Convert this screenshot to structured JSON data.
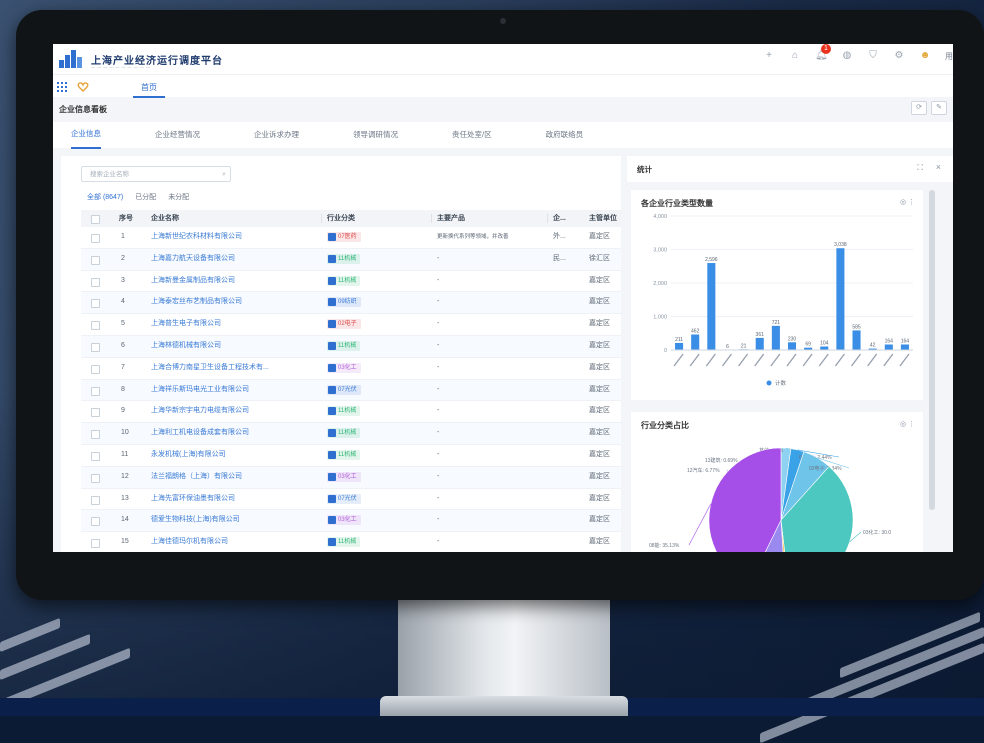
{
  "app": {
    "brand": "上海产业经济运行调度平台",
    "notification_count": "1",
    "user_label": "用"
  },
  "tabs": {
    "home": "首页"
  },
  "page_title": "企业信息看板",
  "subtabs": [
    "企业信息",
    "企业经营情况",
    "企业诉求办理",
    "领导调研情况",
    "责任处室/区",
    "政府联络员"
  ],
  "list": {
    "search_placeholder": "搜索企业名称",
    "filters": [
      "全部 (8647)",
      "已分配",
      "未分配"
    ],
    "columns": [
      "序号",
      "企业名称",
      "行业分类",
      "主要产品",
      "企...",
      "主管单位"
    ],
    "rows": [
      {
        "no": "1",
        "name": "上海新世纪农科材料有限公司",
        "industry": "07医药",
        "industry_color": "#e04b4b",
        "product": "更新换代系列等领域，并改善",
        "unit_short": "外...",
        "dept": "嘉定区"
      },
      {
        "no": "2",
        "name": "上海嘉力航天设备有限公司",
        "industry": "11机械",
        "industry_color": "#2bb673",
        "product": "-",
        "unit_short": "民...",
        "dept": "徐汇区"
      },
      {
        "no": "3",
        "name": "上海新曼金属制品有限公司",
        "industry": "11机械",
        "industry_color": "#2bb673",
        "product": "-",
        "unit_short": "",
        "dept": "嘉定区"
      },
      {
        "no": "4",
        "name": "上海泰宏丝布艺制品有限公司",
        "industry": "09纺织",
        "industry_color": "#3a7bd5",
        "product": "-",
        "unit_short": "",
        "dept": "嘉定区"
      },
      {
        "no": "5",
        "name": "上海普生电子有限公司",
        "industry": "02电子",
        "industry_color": "#e04b4b",
        "product": "-",
        "unit_short": "",
        "dept": "嘉定区"
      },
      {
        "no": "6",
        "name": "上海林德机械有限公司",
        "industry": "11机械",
        "industry_color": "#2bb673",
        "product": "-",
        "unit_short": "",
        "dept": "嘉定区"
      },
      {
        "no": "7",
        "name": "上海合博力南星卫生设备工程技术有...",
        "industry": "03化工",
        "industry_color": "#b35fd6",
        "product": "-",
        "unit_short": "",
        "dept": "嘉定区"
      },
      {
        "no": "8",
        "name": "上海祥乐斯玛电光工业有限公司",
        "industry": "07光伏",
        "industry_color": "#3a7bd5",
        "product": "-",
        "unit_short": "",
        "dept": "嘉定区"
      },
      {
        "no": "9",
        "name": "上海华新宗宇电力电缆有限公司",
        "industry": "11机械",
        "industry_color": "#2bb673",
        "product": "-",
        "unit_short": "",
        "dept": "嘉定区"
      },
      {
        "no": "10",
        "name": "上海利工机电设备成套有限公司",
        "industry": "11机械",
        "industry_color": "#2bb673",
        "product": "-",
        "unit_short": "",
        "dept": "嘉定区"
      },
      {
        "no": "11",
        "name": "永发机械(上海)有限公司",
        "industry": "11机械",
        "industry_color": "#2bb673",
        "product": "-",
        "unit_short": "",
        "dept": "嘉定区"
      },
      {
        "no": "12",
        "name": "法兰福朗格（上海）有限公司",
        "industry": "03化工",
        "industry_color": "#b35fd6",
        "product": "-",
        "unit_short": "",
        "dept": "嘉定区"
      },
      {
        "no": "13",
        "name": "上海先富环保油墨有限公司",
        "industry": "07光伏",
        "industry_color": "#3a7bd5",
        "product": "-",
        "unit_short": "",
        "dept": "嘉定区"
      },
      {
        "no": "14",
        "name": "德爱生物科技(上海)有限公司",
        "industry": "03化工",
        "industry_color": "#b35fd6",
        "product": "-",
        "unit_short": "",
        "dept": "嘉定区"
      },
      {
        "no": "15",
        "name": "上海佳德玛尔机有限公司",
        "industry": "11机械",
        "industry_color": "#2bb673",
        "product": "-",
        "unit_short": "",
        "dept": "嘉定区"
      }
    ]
  },
  "stats": {
    "panel_title": "统计",
    "card1_title": "各企业行业类型数量",
    "card2_title": "行业分类占比"
  },
  "chart_data": [
    {
      "type": "bar",
      "title": "各企业行业类型数量",
      "categories": [
        "c1",
        "c2",
        "c3",
        "c4",
        "c5",
        "c6",
        "c7",
        "c8",
        "c9",
        "c10",
        "c11",
        "c12",
        "c13",
        "c14",
        "c15"
      ],
      "series": [
        {
          "name": "计数",
          "values": [
            211,
            462,
            2596,
            6,
            21,
            361,
            721,
            230,
            69,
            104,
            3038,
            585,
            42,
            164,
            164
          ]
        }
      ],
      "y_ticks": [
        "0",
        "1,000",
        "2,000",
        "3,000",
        "4,000"
      ],
      "ylim": [
        0,
        4000
      ],
      "color": "#3a8ee6"
    },
    {
      "type": "pie",
      "title": "行业分类占比",
      "labels": [
        "其他: 1.8%",
        "01装备: 2.44%",
        "02电子: 5.34%",
        "03化工: 30.0",
        "13建筑: 0.69%",
        "12汽车: 6.77%",
        "08能: 35.13%"
      ],
      "values": [
        1.8,
        2.44,
        5.34,
        30.0,
        0.69,
        6.77,
        35.13
      ],
      "colors": [
        "#8fd1f0",
        "#3aa3e8",
        "#6fc4ea",
        "#4dc8c0",
        "#f5c542",
        "#9a8af0",
        "#a54ee8"
      ]
    }
  ]
}
